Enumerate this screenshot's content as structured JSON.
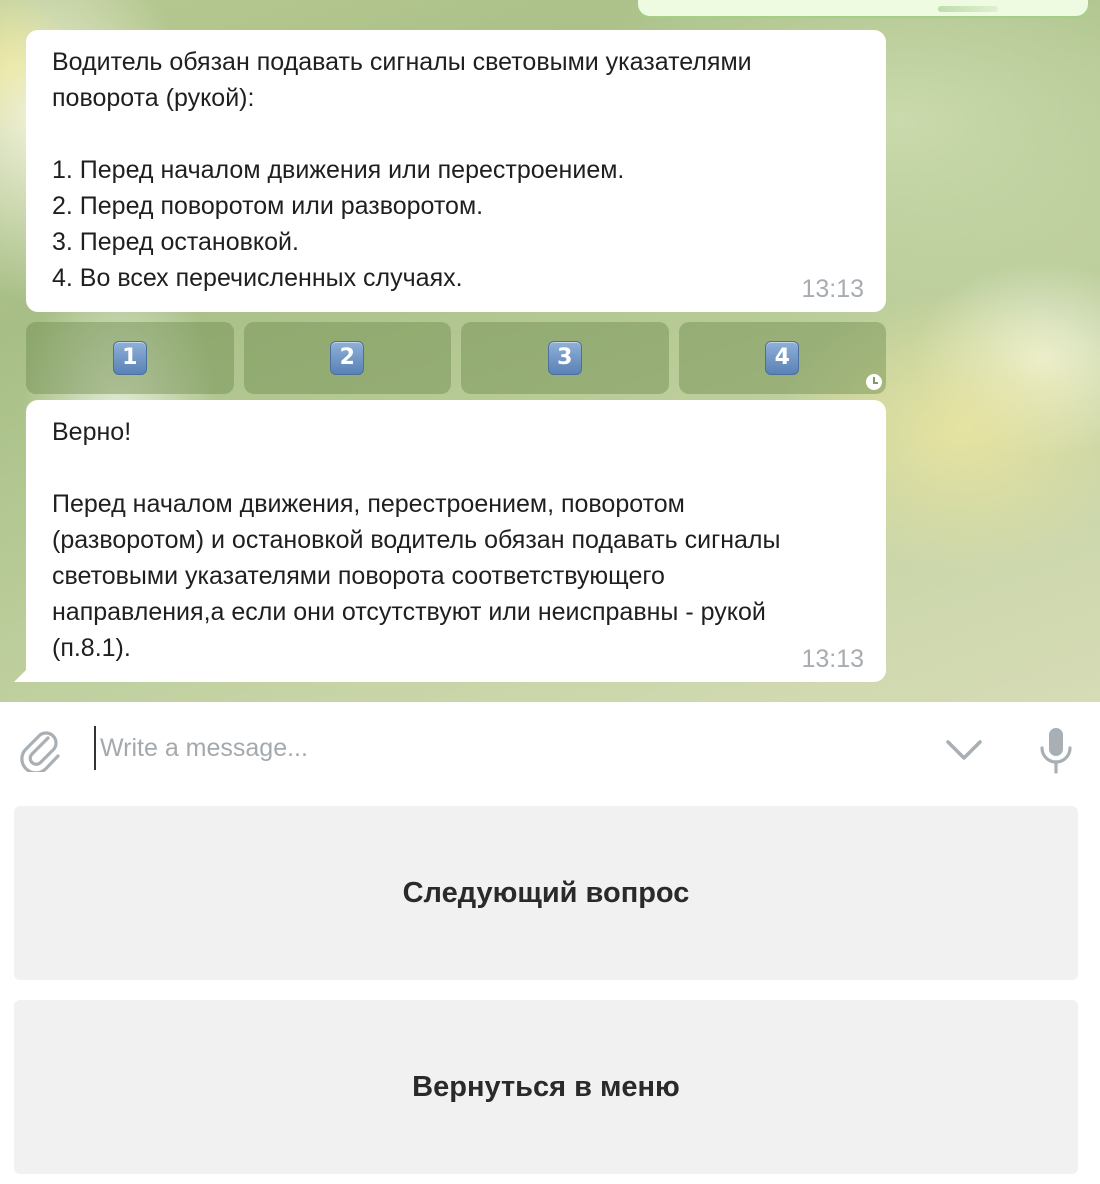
{
  "messages": [
    {
      "text": "Водитель обязан подавать сигналы световыми указателями\nповорота (рукой):\n\n1. Перед началом движения или перестроением.\n2. Перед поворотом или разворотом.\n3. Перед остановкой.\n4. Во всех перечисленных случаях.",
      "time": "13:13"
    },
    {
      "text": "Верно!\n\nПеред началом движения, перестроением, поворотом\n(разворотом) и остановкой водитель обязан подавать сигналы\nсветовыми указателями поворота соответствующего\nнаправления,а если они отсутствуют или неисправны - рукой\n(п.8.1).",
      "time": "13:13"
    }
  ],
  "inline_keyboard": [
    "1",
    "2",
    "3",
    "4"
  ],
  "composer": {
    "placeholder": "Write a message..."
  },
  "icons": {
    "attach": "paperclip-icon",
    "keyboard_toggle": "chevron-down-icon",
    "voice": "microphone-icon",
    "pending": "clock-icon"
  },
  "reply_keyboard": {
    "next_label": "Следующий вопрос",
    "menu_label": "Вернуться в меню"
  },
  "colors": {
    "bubble": "#ffffff",
    "timestamp": "#a6acb2",
    "reply_button_bg": "#f1f1f1",
    "keycap": "#5a82b6"
  }
}
